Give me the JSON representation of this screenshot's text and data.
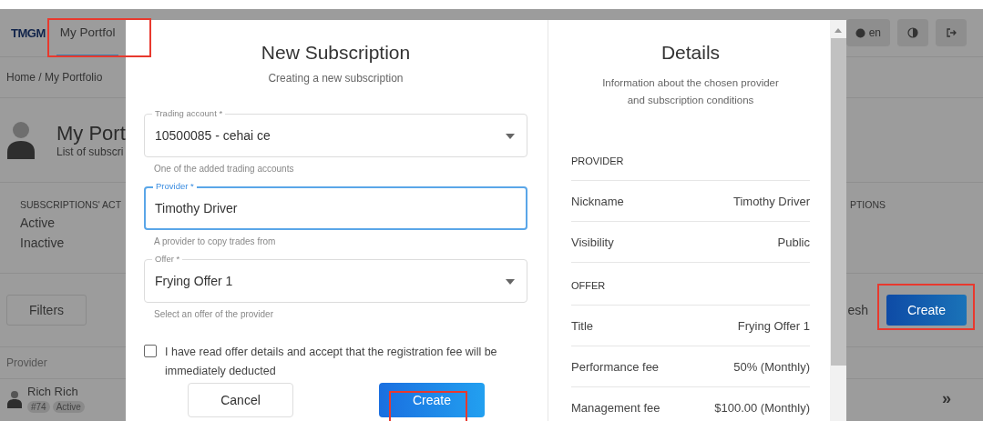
{
  "app_bar": {
    "logo": "TMGM",
    "tab": {
      "label": "My Portfol",
      "selected": true
    },
    "language": "en"
  },
  "breadcrumb": "Home / My Portfolio",
  "page": {
    "title": "My Port",
    "subtitle": "List of subscri"
  },
  "stats": {
    "heading": "SUBSCRIPTIONS' ACT",
    "items": [
      "Active",
      "Inactive"
    ],
    "heading_2": "PTIONS"
  },
  "toolbar": {
    "filters": "Filters",
    "refresh": "esh",
    "create": "Create"
  },
  "table": {
    "column": "Provider",
    "rows": [
      {
        "name": "Rich Rich",
        "badges": [
          "#74",
          "Active"
        ],
        "action": "»"
      }
    ]
  },
  "modal": {
    "title": "New Subscription",
    "subtitle": "Creating a new subscription",
    "fields": [
      {
        "kind": "select",
        "label": "Trading account *",
        "value": "10500085 - cehai ce",
        "hint": "One of the added trading accounts",
        "focused": false
      },
      {
        "kind": "text",
        "label": "Provider *",
        "value": "Timothy Driver",
        "hint": "A provider to copy trades from",
        "focused": true
      },
      {
        "kind": "select",
        "label": "Offer *",
        "value": "Frying Offer 1",
        "hint": "Select an offer of the provider",
        "focused": false
      }
    ],
    "consent": {
      "text": "I have read offer details and accept that the registration fee will be immediately deducted",
      "checked": false
    },
    "cancel": "Cancel",
    "create": "Create",
    "details": {
      "title": "Details",
      "description": "Information about the chosen provider and subscription conditions",
      "sections": [
        {
          "heading": "PROVIDER",
          "rows": [
            {
              "label": "Nickname",
              "value": "Timothy Driver"
            },
            {
              "label": "Visibility",
              "value": "Public"
            }
          ]
        },
        {
          "heading": "OFFER",
          "rows": [
            {
              "label": "Title",
              "value": "Frying Offer 1"
            },
            {
              "label": "Performance fee",
              "value": "50% (Monthly)"
            },
            {
              "label": "Management fee",
              "value": "$100.00 (Monthly)"
            }
          ]
        }
      ]
    }
  }
}
